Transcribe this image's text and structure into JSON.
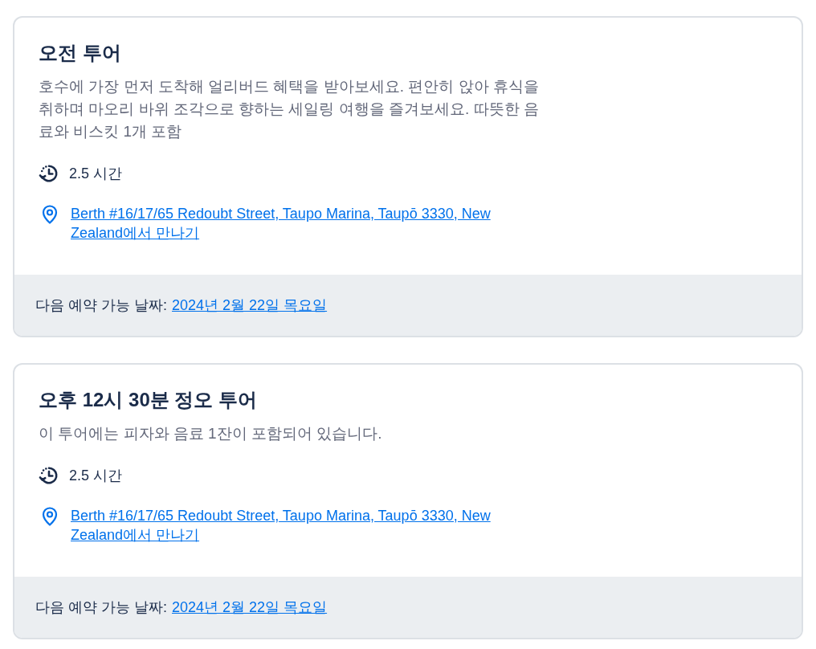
{
  "tours": [
    {
      "title": "오전 투어",
      "description": "호수에 가장 먼저 도착해 얼리버드 혜택을 받아보세요. 편안히 앉아 휴식을 취하며 마오리 바위 조각으로 향하는 세일링 여행을 즐겨보세요. 따뜻한 음료와 비스킷 1개 포함",
      "duration": "2.5 시간",
      "meeting_point": "Berth #16/17/65 Redoubt Street, Taupo Marina, Taupō 3330, New Zealand에서 만나기",
      "next_available_label": "다음 예약 가능 날짜:",
      "next_available_date": "2024년 2월 22일 목요일"
    },
    {
      "title": "오후 12시 30분 정오 투어",
      "description": "이 투어에는 피자와 음료 1잔이 포함되어 있습니다.",
      "duration": "2.5 시간",
      "meeting_point": "Berth #16/17/65 Redoubt Street, Taupo Marina, Taupō 3330, New Zealand에서 만나기",
      "next_available_label": "다음 예약 가능 날짜:",
      "next_available_date": "2024년 2월 22일 목요일"
    }
  ]
}
